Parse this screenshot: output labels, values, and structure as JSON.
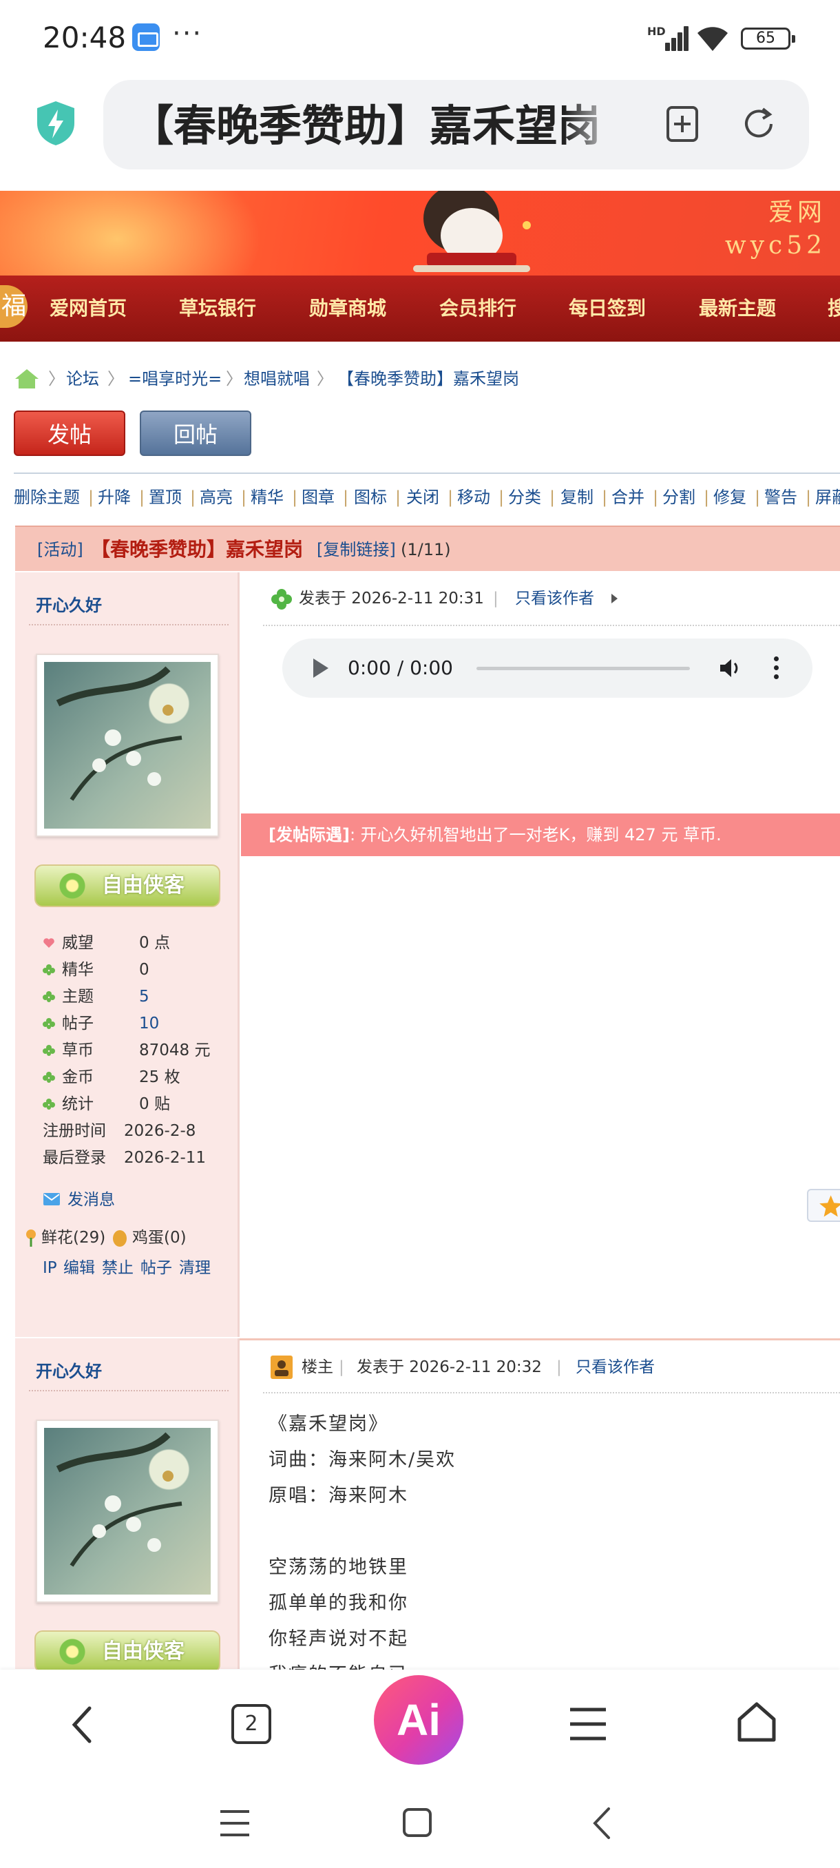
{
  "status_bar": {
    "time": "20:48",
    "dots": "···",
    "network_label": "HD",
    "battery": "65"
  },
  "browser": {
    "address_text": "【春晚季赞助】嘉禾望岗",
    "icons": [
      "shield-icon",
      "add-bookmark-icon",
      "reload-icon"
    ]
  },
  "site": {
    "banner_text_line1": "爱网",
    "banner_text_line2": "wyc52",
    "nav_logo": "福",
    "nav": [
      "爱网首页",
      "草坛银行",
      "勋章商城",
      "会员排行",
      "每日签到",
      "最新主题",
      "搜"
    ]
  },
  "breadcrumb": [
    "论坛",
    "=唱享时光=",
    "想唱就唱",
    "【春晚季赞助】嘉禾望岗"
  ],
  "buttons": {
    "post": "发帖",
    "reply": "回帖"
  },
  "admin_tools": [
    "删除主题",
    "升降",
    "置顶",
    "高亮",
    "精华",
    "图章",
    "图标",
    "关闭",
    "移动",
    "分类",
    "复制",
    "合并",
    "分割",
    "修复",
    "警告",
    "屏蔽"
  ],
  "thread": {
    "tag": "[活动]",
    "title": "【春晚季赞助】嘉禾望岗",
    "copy_link": "[复制链接]",
    "page": "(1/11)"
  },
  "posts": [
    {
      "author": "开心久好",
      "badge": "自由侠客",
      "stats": [
        {
          "label": "威望",
          "value": "0 点",
          "icon": "heart"
        },
        {
          "label": "精华",
          "value": "0",
          "icon": "clover"
        },
        {
          "label": "主题",
          "value": "5",
          "icon": "clover",
          "link": true
        },
        {
          "label": "帖子",
          "value": "10",
          "icon": "clover",
          "link": true
        },
        {
          "label": "草币",
          "value": "87048 元",
          "icon": "clover"
        },
        {
          "label": "金币",
          "value": "25 枚",
          "icon": "clover"
        },
        {
          "label": "统计",
          "value": "0 贴",
          "icon": "clover"
        },
        {
          "label": "注册时间",
          "value": "2026-2-8",
          "icon": ""
        },
        {
          "label": "最后登录",
          "value": "2026-2-11",
          "icon": ""
        }
      ],
      "send_message": "发消息",
      "flowers": "鲜花(29)",
      "eggs": "鸡蛋(0)",
      "mod_links": [
        "IP",
        "编辑",
        "禁止",
        "帖子",
        "清理"
      ],
      "posted_at": "发表于 2026-2-11 20:31",
      "only_author": "只看该作者",
      "audio_time": "0:00 / 0:00",
      "notice_label": "[发帖际遇]",
      "notice_text": ": 开心久好机智地出了一对老K，赚到 427 元 草币."
    },
    {
      "author": "开心久好",
      "badge": "自由侠客",
      "role": "楼主",
      "posted_at": "发表于 2026-2-11 20:32",
      "only_author": "只看该作者",
      "lyrics": [
        "《嘉禾望岗》",
        "词曲：海来阿木/吴欢",
        "原唱：海来阿木",
        "",
        "空荡荡的地铁里",
        "孤单单的我和你",
        "你轻声说对不起",
        "我痛的不能自已"
      ]
    }
  ],
  "bottom_toolbar": {
    "tabs_count": "2",
    "ai_label": "Ai"
  }
}
